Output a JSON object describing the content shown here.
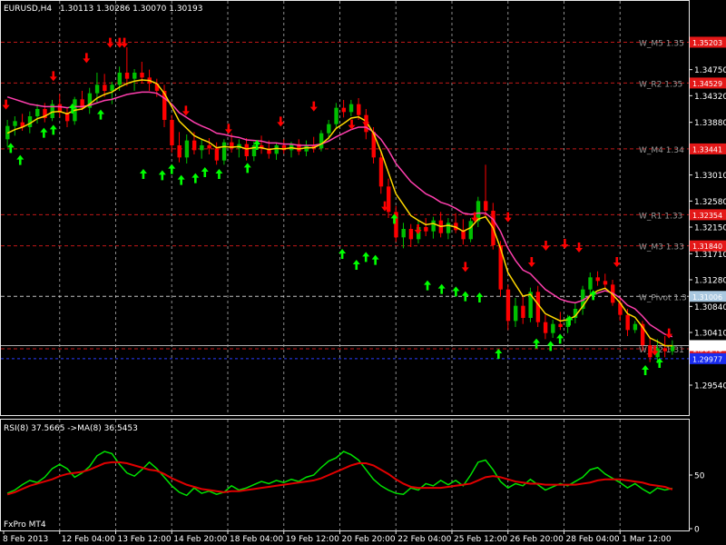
{
  "header": {
    "symbol": "EURUSD,H4",
    "ohlc": "1.30113 1.30286 1.30070 1.30193"
  },
  "rsi_header": "RSI(8) 37.5665  ->MA(8) 36.5453",
  "watermark": "FxPro MT4",
  "colors": {
    "background": "#000000",
    "bull": "#00c000",
    "bear": "#ff0000",
    "ema_fast": "#ffd700",
    "ema_slow": "#ff3fae",
    "level_line": "#c01818",
    "up_arrow": "#00ff00",
    "down_arrow": "#ff0000",
    "rsi_line": "#00e000",
    "rsi_ma": "#e00000"
  },
  "chart_data": [
    {
      "type": "candlestick",
      "title": "EURUSD,H4",
      "ylim": [
        1.2912,
        1.3584
      ],
      "price_ticks": [
        "1.34750",
        "1.34320",
        "1.33880",
        "1.33450",
        "1.33010",
        "1.32580",
        "1.32150",
        "1.31710",
        "1.31280",
        "1.30840",
        "1.30410",
        "1.29970",
        "1.29540"
      ],
      "price_tick_values": [
        1.3475,
        1.3432,
        1.3388,
        1.3345,
        1.3301,
        1.3258,
        1.3215,
        1.3171,
        1.3128,
        1.3084,
        1.3041,
        1.2997,
        1.2954
      ],
      "time_labels": [
        "8 Feb 2013",
        "12 Feb 04:00",
        "13 Feb 12:00",
        "14 Feb 20:00",
        "18 Feb 04:00",
        "19 Feb 12:00",
        "20 Feb 20:00",
        "22 Feb 04:00",
        "25 Feb 12:00",
        "26 Feb 20:00",
        "28 Feb 04:00",
        "1 Mar 12:00"
      ],
      "levels": [
        {
          "name": "W_M5 1.35",
          "tag": "1.35203",
          "value": 1.35203
        },
        {
          "name": "W_R2 1.35",
          "tag": "1.34529",
          "value": 1.34529
        },
        {
          "name": "W_M4 1.34",
          "tag": "1.33441",
          "value": 1.33441
        },
        {
          "name": "W_R1 1.33",
          "tag": "1.32354",
          "value": 1.32354
        },
        {
          "name": "W_M3 1.33",
          "tag": "1.31840",
          "value": 1.3184
        },
        {
          "name": "W_Pivot 1.3",
          "tag": "1.31006",
          "value": 1.31006
        },
        {
          "name": "W_M2 1.31",
          "tag": "1.30140",
          "value": 1.3014
        }
      ],
      "current_price": {
        "tag": "1.30193",
        "value": 1.30193
      },
      "blue_level": {
        "tag": "1.29977",
        "value": 1.29977
      },
      "candles": [
        [
          1.336,
          1.3392,
          1.3348,
          1.3382
        ],
        [
          1.3382,
          1.3398,
          1.3366,
          1.339
        ],
        [
          1.3388,
          1.3402,
          1.3374,
          1.338
        ],
        [
          1.338,
          1.3406,
          1.337,
          1.3398
        ],
        [
          1.3398,
          1.3418,
          1.3386,
          1.341
        ],
        [
          1.341,
          1.342,
          1.3388,
          1.3395
        ],
        [
          1.3395,
          1.3425,
          1.339,
          1.3418
        ],
        [
          1.3418,
          1.3435,
          1.3396,
          1.3404
        ],
        [
          1.3404,
          1.3412,
          1.338,
          1.339
        ],
        [
          1.339,
          1.343,
          1.3384,
          1.3426
        ],
        [
          1.3426,
          1.344,
          1.3408,
          1.3412
        ],
        [
          1.3412,
          1.3445,
          1.3402,
          1.3436
        ],
        [
          1.3436,
          1.347,
          1.342,
          1.345
        ],
        [
          1.345,
          1.3468,
          1.343,
          1.344
        ],
        [
          1.344,
          1.3455,
          1.3418,
          1.345
        ],
        [
          1.345,
          1.348,
          1.344,
          1.347
        ],
        [
          1.347,
          1.3512,
          1.3448,
          1.346
        ],
        [
          1.346,
          1.3476,
          1.344,
          1.347
        ],
        [
          1.347,
          1.3488,
          1.3452,
          1.3462
        ],
        [
          1.3462,
          1.3475,
          1.344,
          1.3452
        ],
        [
          1.3452,
          1.346,
          1.343,
          1.344
        ],
        [
          1.344,
          1.345,
          1.338,
          1.3392
        ],
        [
          1.3392,
          1.34,
          1.3338,
          1.335
        ],
        [
          1.335,
          1.3372,
          1.3322,
          1.333
        ],
        [
          1.333,
          1.3368,
          1.332,
          1.3358
        ],
        [
          1.3358,
          1.3372,
          1.3335,
          1.3342
        ],
        [
          1.3342,
          1.336,
          1.3328,
          1.335
        ],
        [
          1.335,
          1.3362,
          1.3335,
          1.3345
        ],
        [
          1.3345,
          1.3355,
          1.3318,
          1.3325
        ],
        [
          1.3325,
          1.336,
          1.3318,
          1.3355
        ],
        [
          1.3355,
          1.337,
          1.3338,
          1.3345
        ],
        [
          1.3345,
          1.336,
          1.333,
          1.3352
        ],
        [
          1.3352,
          1.3362,
          1.3325,
          1.3332
        ],
        [
          1.3332,
          1.3356,
          1.3324,
          1.335
        ],
        [
          1.335,
          1.3366,
          1.3336,
          1.3345
        ],
        [
          1.3345,
          1.3358,
          1.3328,
          1.3336
        ],
        [
          1.3336,
          1.3354,
          1.3326,
          1.335
        ],
        [
          1.335,
          1.336,
          1.3336,
          1.3342
        ],
        [
          1.3342,
          1.3356,
          1.333,
          1.3352
        ],
        [
          1.3352,
          1.336,
          1.3334,
          1.334
        ],
        [
          1.334,
          1.3358,
          1.3332,
          1.335
        ],
        [
          1.335,
          1.3364,
          1.3338,
          1.3345
        ],
        [
          1.3345,
          1.3375,
          1.334,
          1.337
        ],
        [
          1.337,
          1.3392,
          1.336,
          1.3385
        ],
        [
          1.3385,
          1.342,
          1.3378,
          1.3412
        ],
        [
          1.3412,
          1.3425,
          1.3396,
          1.3405
        ],
        [
          1.3405,
          1.3425,
          1.3398,
          1.3418
        ],
        [
          1.3418,
          1.3428,
          1.3392,
          1.34
        ],
        [
          1.34,
          1.341,
          1.336,
          1.3372
        ],
        [
          1.3372,
          1.338,
          1.332,
          1.333
        ],
        [
          1.333,
          1.334,
          1.327,
          1.3282
        ],
        [
          1.3282,
          1.3295,
          1.323,
          1.324
        ],
        [
          1.324,
          1.325,
          1.319,
          1.3198
        ],
        [
          1.3198,
          1.3222,
          1.318,
          1.3212
        ],
        [
          1.3212,
          1.322,
          1.3182,
          1.3195
        ],
        [
          1.3195,
          1.3225,
          1.3188,
          1.3215
        ],
        [
          1.3215,
          1.323,
          1.32,
          1.3208
        ],
        [
          1.3208,
          1.3232,
          1.3196,
          1.3226
        ],
        [
          1.3226,
          1.324,
          1.3198,
          1.3205
        ],
        [
          1.3205,
          1.323,
          1.3195,
          1.3222
        ],
        [
          1.3222,
          1.3238,
          1.3205,
          1.321
        ],
        [
          1.321,
          1.3228,
          1.3186,
          1.3195
        ],
        [
          1.3195,
          1.323,
          1.319,
          1.3225
        ],
        [
          1.3225,
          1.3265,
          1.3215,
          1.3258
        ],
        [
          1.3258,
          1.3318,
          1.3232,
          1.3242
        ],
        [
          1.3242,
          1.3255,
          1.3178,
          1.3185
        ],
        [
          1.3185,
          1.3192,
          1.31,
          1.3112
        ],
        [
          1.3112,
          1.312,
          1.3045,
          1.306
        ],
        [
          1.306,
          1.3098,
          1.305,
          1.3085
        ],
        [
          1.3085,
          1.31,
          1.3055,
          1.3065
        ],
        [
          1.3065,
          1.3115,
          1.3058,
          1.3108
        ],
        [
          1.3108,
          1.3118,
          1.305,
          1.3058
        ],
        [
          1.3058,
          1.307,
          1.303,
          1.304
        ],
        [
          1.304,
          1.3062,
          1.3032,
          1.3055
        ],
        [
          1.3055,
          1.3075,
          1.3045,
          1.305
        ],
        [
          1.305,
          1.307,
          1.304,
          1.3065
        ],
        [
          1.3065,
          1.309,
          1.3056,
          1.308
        ],
        [
          1.308,
          1.3118,
          1.307,
          1.3112
        ],
        [
          1.3112,
          1.314,
          1.31,
          1.3132
        ],
        [
          1.3132,
          1.3142,
          1.3118,
          1.3126
        ],
        [
          1.3126,
          1.3138,
          1.3112,
          1.312
        ],
        [
          1.312,
          1.3128,
          1.3085,
          1.309
        ],
        [
          1.309,
          1.31,
          1.306,
          1.307
        ],
        [
          1.307,
          1.308,
          1.3035,
          1.3045
        ],
        [
          1.3045,
          1.306,
          1.304,
          1.3055
        ],
        [
          1.3055,
          1.306,
          1.301,
          1.302
        ],
        [
          1.302,
          1.3032,
          1.2992,
          1.3
        ],
        [
          1.3,
          1.303,
          1.299,
          1.3015
        ],
        [
          1.3015,
          1.3035,
          1.3,
          1.301
        ],
        [
          1.301,
          1.3028,
          1.3004,
          1.3019
        ]
      ],
      "ema_fast": [
        1.337,
        1.3376,
        1.338,
        1.3386,
        1.3394,
        1.3398,
        1.3405,
        1.3406,
        1.3402,
        1.3408,
        1.341,
        1.3418,
        1.3428,
        1.3434,
        1.3438,
        1.3446,
        1.3452,
        1.3456,
        1.3458,
        1.3457,
        1.3452,
        1.3436,
        1.3414,
        1.339,
        1.3378,
        1.3366,
        1.336,
        1.3355,
        1.3346,
        1.3348,
        1.3347,
        1.3348,
        1.3344,
        1.3346,
        1.3346,
        1.3343,
        1.3345,
        1.3344,
        1.3346,
        1.3344,
        1.3346,
        1.3346,
        1.3352,
        1.3362,
        1.3378,
        1.3386,
        1.3395,
        1.3397,
        1.339,
        1.337,
        1.334,
        1.3305,
        1.327,
        1.3252,
        1.3234,
        1.3226,
        1.3219,
        1.3221,
        1.3216,
        1.3218,
        1.3215,
        1.3208,
        1.3214,
        1.3228,
        1.3232,
        1.3214,
        1.318,
        1.314,
        1.312,
        1.3101,
        1.3104,
        1.3088,
        1.3072,
        1.3066,
        1.306,
        1.3062,
        1.3068,
        1.3084,
        1.3102,
        1.311,
        1.3114,
        1.3104,
        1.309,
        1.3072,
        1.3066,
        1.305,
        1.3032,
        1.3026,
        1.3019,
        1.3019
      ],
      "ema_slow": [
        1.343,
        1.3426,
        1.3422,
        1.3418,
        1.3416,
        1.3414,
        1.3414,
        1.3414,
        1.3412,
        1.3414,
        1.3414,
        1.3416,
        1.342,
        1.3424,
        1.3426,
        1.343,
        1.3434,
        1.3436,
        1.3438,
        1.3438,
        1.3436,
        1.3428,
        1.3418,
        1.3404,
        1.3396,
        1.3388,
        1.3382,
        1.3377,
        1.337,
        1.3368,
        1.3365,
        1.3363,
        1.3359,
        1.3358,
        1.3357,
        1.3354,
        1.3354,
        1.3352,
        1.3352,
        1.335,
        1.335,
        1.335,
        1.3352,
        1.3357,
        1.3364,
        1.337,
        1.3376,
        1.338,
        1.338,
        1.3372,
        1.336,
        1.3342,
        1.332,
        1.3305,
        1.329,
        1.328,
        1.327,
        1.3264,
        1.3256,
        1.3252,
        1.3246,
        1.3238,
        1.3236,
        1.3238,
        1.3238,
        1.3228,
        1.3208,
        1.318,
        1.316,
        1.3144,
        1.3138,
        1.3125,
        1.3112,
        1.3104,
        1.3096,
        1.3092,
        1.309,
        1.3094,
        1.3102,
        1.3106,
        1.311,
        1.3106,
        1.3098,
        1.3086,
        1.308,
        1.3068,
        1.3054,
        1.3046,
        1.3038,
        1.3034
      ],
      "arrows_up": [
        [
          1,
          1.3345
        ],
        [
          3,
          1.3325
        ],
        [
          8,
          1.337
        ],
        [
          10,
          1.3375
        ],
        [
          14,
          1.341
        ],
        [
          20,
          1.34
        ],
        [
          29,
          1.3302
        ],
        [
          33,
          1.33
        ],
        [
          35,
          1.331
        ],
        [
          37,
          1.3292
        ],
        [
          40,
          1.3295
        ],
        [
          42,
          1.3305
        ],
        [
          45,
          1.3302
        ],
        [
          51,
          1.3312
        ],
        [
          53,
          1.335
        ],
        [
          71,
          1.317
        ],
        [
          74,
          1.3152
        ],
        [
          76,
          1.3165
        ],
        [
          78,
          1.316
        ],
        [
          82,
          1.3228
        ],
        [
          89,
          1.3118
        ],
        [
          92,
          1.3112
        ],
        [
          95,
          1.3108
        ],
        [
          97,
          1.31
        ],
        [
          100,
          1.3098
        ],
        [
          104,
          1.3005
        ],
        [
          112,
          1.3022
        ],
        [
          115,
          1.3018
        ],
        [
          117,
          1.303
        ],
        [
          119,
          1.306
        ],
        [
          124,
          1.3102
        ],
        [
          135,
          1.2978
        ],
        [
          138,
          1.299
        ]
      ],
      "arrows_down": [
        [
          0,
          1.3418
        ],
        [
          10,
          1.3465
        ],
        [
          17,
          1.3495
        ],
        [
          22,
          1.352
        ],
        [
          24,
          1.352
        ],
        [
          25,
          1.352
        ],
        [
          38,
          1.3408
        ],
        [
          47,
          1.3378
        ],
        [
          58,
          1.339
        ],
        [
          65,
          1.3415
        ],
        [
          73,
          1.3385
        ],
        [
          76,
          1.339
        ],
        [
          80,
          1.325
        ],
        [
          87,
          1.3212
        ],
        [
          97,
          1.315
        ],
        [
          99,
          1.3232
        ],
        [
          106,
          1.3232
        ],
        [
          111,
          1.3158
        ],
        [
          114,
          1.3185
        ],
        [
          118,
          1.3188
        ],
        [
          121,
          1.3182
        ],
        [
          129,
          1.3158
        ],
        [
          137,
          1.3012
        ],
        [
          140,
          1.304
        ]
      ],
      "arrow_x_slots": 142
    },
    {
      "type": "line",
      "title": "RSI(8) 37.5665  ->MA(8) 36.5453",
      "ylim": [
        0,
        100
      ],
      "y_ticks": [
        "50",
        "0"
      ],
      "series": [
        {
          "name": "RSI(8)",
          "values": [
            33,
            36,
            41,
            45,
            43,
            48,
            56,
            60,
            56,
            48,
            52,
            58,
            68,
            72,
            70,
            60,
            52,
            49,
            55,
            62,
            56,
            48,
            40,
            34,
            31,
            38,
            33,
            35,
            32,
            34,
            40,
            36,
            38,
            41,
            44,
            42,
            45,
            43,
            46,
            44,
            48,
            50,
            57,
            63,
            66,
            72,
            69,
            64,
            55,
            46,
            40,
            36,
            33,
            32,
            38,
            36,
            42,
            40,
            45,
            41,
            45,
            40,
            50,
            62,
            64,
            55,
            44,
            38,
            42,
            40,
            46,
            41,
            36,
            39,
            42,
            40,
            44,
            48,
            55,
            57,
            51,
            47,
            43,
            38,
            42,
            37,
            33,
            38,
            36,
            37.57
          ]
        },
        {
          "name": "->MA(8)",
          "values": [
            32,
            34,
            37,
            40,
            42,
            44,
            46,
            49,
            51,
            52,
            53,
            55,
            58,
            61,
            62,
            62,
            61,
            59,
            57,
            55,
            54,
            51,
            47,
            44,
            41,
            39,
            37,
            36,
            35,
            34,
            35,
            35,
            36,
            37,
            38,
            39,
            40,
            41,
            42,
            43,
            44,
            45,
            47,
            50,
            53,
            56,
            59,
            61,
            61,
            59,
            55,
            51,
            46,
            42,
            39,
            38,
            38,
            38,
            38,
            39,
            40,
            41,
            42,
            45,
            48,
            49,
            48,
            46,
            44,
            43,
            42,
            42,
            41,
            41,
            41,
            41,
            41,
            42,
            43,
            45,
            46,
            46,
            46,
            45,
            44,
            43,
            41,
            40,
            39,
            36.55
          ]
        }
      ]
    }
  ]
}
